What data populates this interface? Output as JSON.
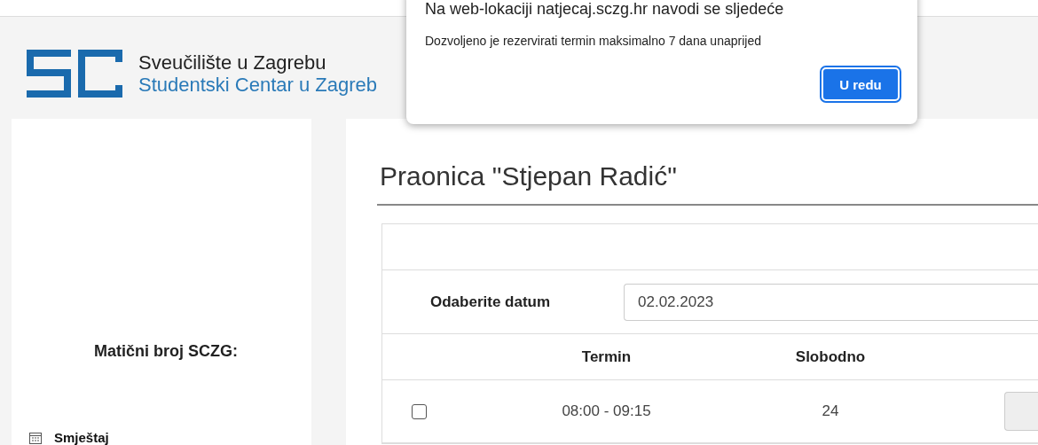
{
  "header": {
    "title": "Sveučilište u Zagrebu",
    "subtitle": "Studentski Centar u Zagreb"
  },
  "sidebar": {
    "label": "Matični broj SCZG:",
    "items": [
      {
        "label": "Smještaj"
      }
    ]
  },
  "page": {
    "title": "Praonica \"Stjepan Radić\"",
    "date_label": "Odaberite datum",
    "date_value": "02.02.2023",
    "table": {
      "columns": [
        "Termin",
        "Slobodno"
      ],
      "rows": [
        {
          "checked": false,
          "termin": "08:00 - 09:15",
          "slobodno": "24"
        }
      ]
    }
  },
  "dialog": {
    "title": "Na web-lokaciji natjecaj.sczg.hr navodi se sljedeće",
    "message": "Dozvoljeno je rezervirati termin maksimalno 7 dana unaprijed",
    "button": "U redu"
  }
}
